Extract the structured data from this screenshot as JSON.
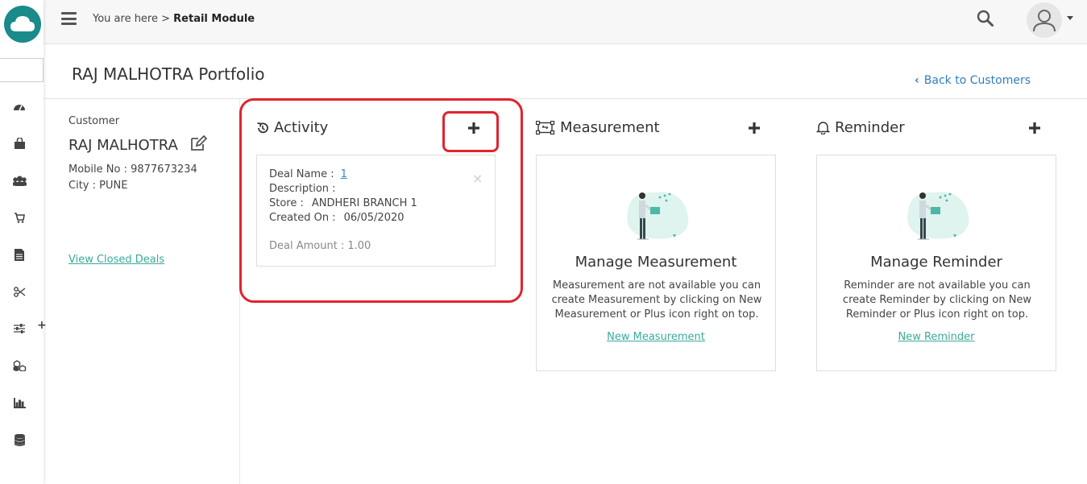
{
  "rail": {
    "icons": [
      "dashboard-icon",
      "shopping-bag-icon",
      "users-icon",
      "cart-icon",
      "document-icon",
      "scissors-icon",
      "sliders-icon",
      "cubes-icon",
      "bar-chart-icon",
      "database-icon"
    ],
    "plus": "+"
  },
  "topbar": {
    "breadcrumb_prefix": "You are here >",
    "breadcrumb_current": "Retail Module"
  },
  "page": {
    "title": "RAJ MALHOTRA Portfolio",
    "back_label": "Back to Customers"
  },
  "customer": {
    "label": "Customer",
    "name": "RAJ MALHOTRA",
    "mobile": "Mobile No : 9877673234",
    "city": "City : PUNE",
    "view_closed": "View Closed Deals"
  },
  "activity": {
    "title": "Activity",
    "card": {
      "deal_name_label": "Deal Name :",
      "deal_name_value": "1",
      "description_label": "Description :",
      "store_label": "Store :",
      "store_value": "ANDHERI BRANCH 1",
      "created_label": "Created On :",
      "created_value": "06/05/2020",
      "amount_label": "Deal Amount :",
      "amount_value": "1.00",
      "close": "×"
    }
  },
  "measurement": {
    "title": "Measurement",
    "empty_title": "Manage Measurement",
    "empty_desc": "Measurement are not available you can create Measurement by clicking on New Measurement or Plus icon right on top.",
    "new_link": "New Measurement"
  },
  "reminder": {
    "title": "Reminder",
    "empty_title": "Manage Reminder",
    "empty_desc": "Reminder are not available you can create Reminder by clicking on New Reminder or Plus icon right on top.",
    "new_link": "New Reminder"
  },
  "colors": {
    "brand_teal": "#1a8a8a",
    "link_blue": "#2f7fc1",
    "link_teal": "#3aaa9a",
    "annotation_red": "#e0242f"
  }
}
